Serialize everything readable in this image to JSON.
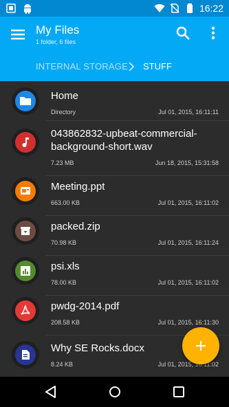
{
  "status_bar": {
    "time": "16:22"
  },
  "app_bar": {
    "title": "My Files",
    "subtitle": "1 folder, 6 files",
    "breadcrumbs": [
      "INTERNAL STORAGE",
      "STUFF"
    ]
  },
  "files": [
    {
      "name": "Home",
      "meta_left": "Directory",
      "meta_right": "Jul 01, 2015, 16:11:11",
      "icon": "folder-icon",
      "color": "#1e88e5"
    },
    {
      "name": "043862832-upbeat-commercial-background-short.wav",
      "meta_left": "7.23 MB",
      "meta_right": "Jun 18, 2015, 15:31:58",
      "icon": "music-note-icon",
      "color": "#d32f2f"
    },
    {
      "name": "Meeting.ppt",
      "meta_left": "663.00 KB",
      "meta_right": "Jul 01, 2015, 16:11:02",
      "icon": "presentation-icon",
      "color": "#f57c00"
    },
    {
      "name": "packed.zip",
      "meta_left": "70.98 KB",
      "meta_right": "Jul 01, 2015, 16:11:24",
      "icon": "archive-icon",
      "color": "#6d4c41"
    },
    {
      "name": "psi.xls",
      "meta_left": "78.00 KB",
      "meta_right": "Jul 01, 2015, 16:11:02",
      "icon": "spreadsheet-icon",
      "color": "#558b2f"
    },
    {
      "name": "pwdg-2014.pdf",
      "meta_left": "208.58 KB",
      "meta_right": "Jul 01, 2015, 16:11:30",
      "icon": "pdf-icon",
      "color": "#e53935"
    },
    {
      "name": "Why SE Rocks.docx",
      "meta_left": "8.24 KB",
      "meta_right": "Jul 01, 2015, 16:11:02",
      "icon": "document-icon",
      "color": "#283593"
    }
  ],
  "colors": {
    "status_bar": "#0288d1",
    "app_bar": "#03a9f4",
    "fab": "#ffb300",
    "list_background": "#2c2c2c"
  }
}
